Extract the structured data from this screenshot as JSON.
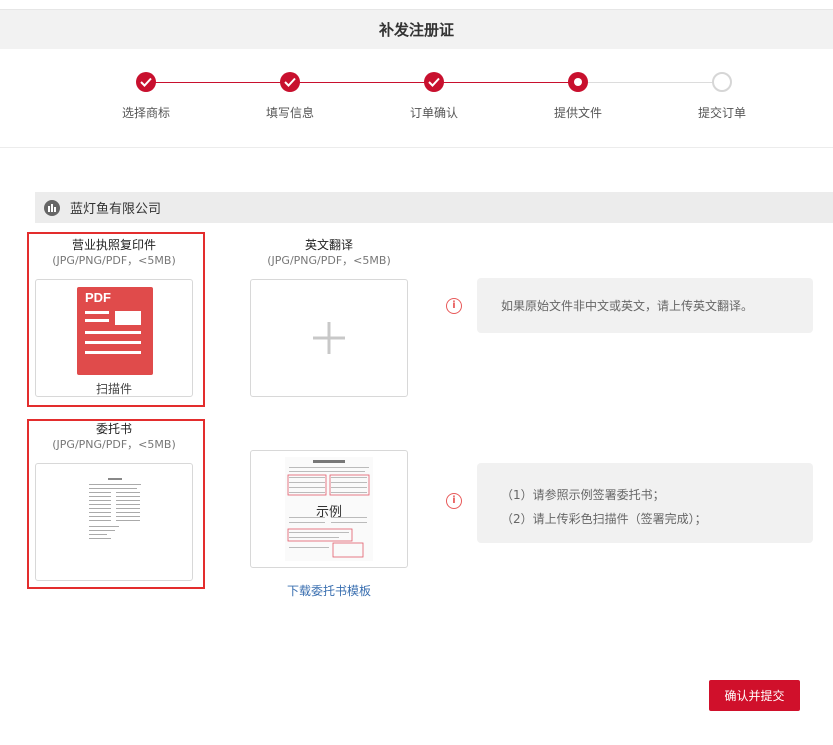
{
  "header": {
    "title": "补发注册证"
  },
  "steps": [
    {
      "label": "选择商标",
      "state": "done"
    },
    {
      "label": "填写信息",
      "state": "done"
    },
    {
      "label": "订单确认",
      "state": "done"
    },
    {
      "label": "提供文件",
      "state": "current"
    },
    {
      "label": "提交订单",
      "state": "todo"
    }
  ],
  "company": {
    "name": "蓝灯鱼有限公司",
    "icon": "building-icon"
  },
  "uploads": {
    "license": {
      "title": "营业执照复印件",
      "hint": "(JPG/PNG/PDF，<5MB)",
      "file_badge": "PDF",
      "file_caption": "扫描件"
    },
    "translation": {
      "title": "英文翻译",
      "hint": "(JPG/PNG/PDF，<5MB)",
      "icon": "plus-icon"
    },
    "translation_tip": "如果原始文件非中文或英文，请上传英文翻译。",
    "poa": {
      "title": "委托书",
      "hint": "(JPG/PNG/PDF，<5MB)"
    },
    "sample": {
      "label": "示例",
      "download_link": "下载委托书模板"
    },
    "poa_tips": [
      "（1）请参照示例签署委托书；",
      "（2）请上传彩色扫描件（签署完成）；"
    ]
  },
  "actions": {
    "submit": "确认并提交"
  },
  "colors": {
    "accent": "#c8102e",
    "highlight_frame": "#e32d2d",
    "link": "#3a6fb0"
  }
}
